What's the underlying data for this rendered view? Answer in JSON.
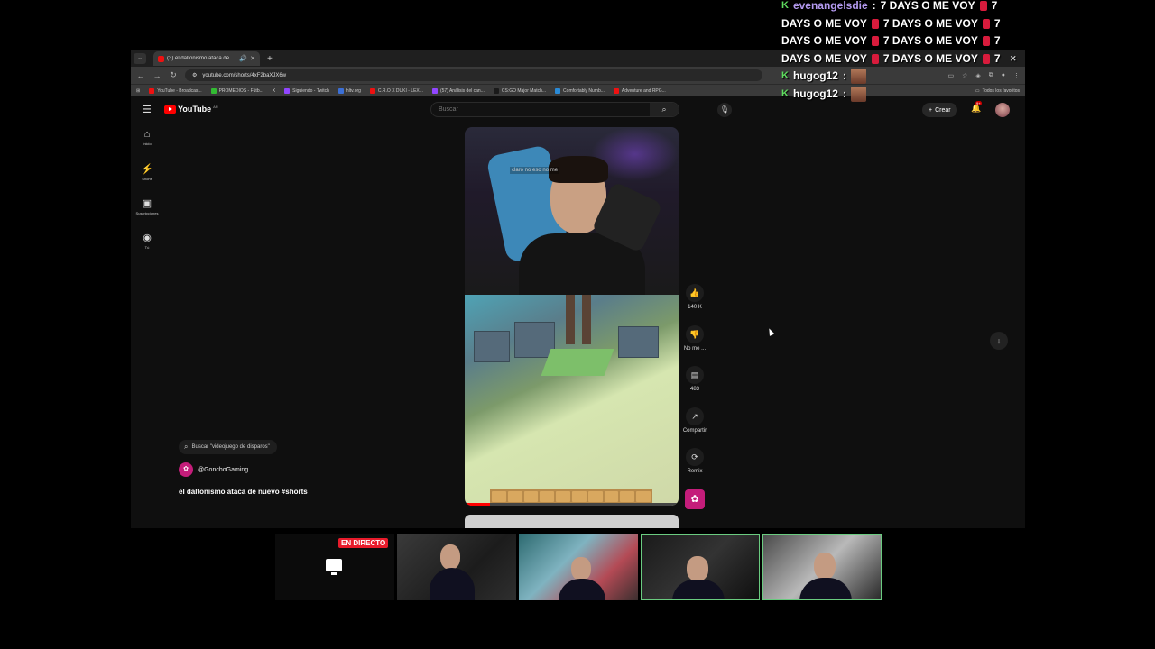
{
  "browser": {
    "tab_title": "(3) el daltonismo ataca de ...",
    "url": "youtube.com/shorts/4xF2baXJX6w",
    "bookmarks": [
      {
        "label": "YouTube - Broadcas...",
        "color": "#e11"
      },
      {
        "label": "PROMEDIOS - Fútb...",
        "color": "#3b3"
      },
      {
        "label": "X",
        "color": "#000"
      },
      {
        "label": "Siguiendo - Twitch",
        "color": "#9146ff"
      },
      {
        "label": "hltv.org",
        "color": "#3b6fd6"
      },
      {
        "label": "C.R.O X DUKI - LEX...",
        "color": "#e11"
      },
      {
        "label": "(57) Análisis del can...",
        "color": "#9146ff"
      },
      {
        "label": "CS:GO Major Match...",
        "color": "#1a1a1a"
      },
      {
        "label": "Comfortably Numb...",
        "color": "#2a8ad6"
      },
      {
        "label": "Adventure and RPG...",
        "color": "#e11"
      }
    ],
    "all_bookmarks": "Todos los favoritos"
  },
  "youtube": {
    "logo": "YouTube",
    "country": "AR",
    "search_placeholder": "Buscar",
    "create_label": "Crear",
    "notification_count": "9+",
    "guide": [
      {
        "icon": "⌂",
        "label": "Inicio"
      },
      {
        "icon": "⚡",
        "label": "Shorts"
      },
      {
        "icon": "▣",
        "label": "Suscripciones"
      },
      {
        "icon": "◉",
        "label": "Tú"
      }
    ],
    "short": {
      "caption": "claro no eso no me",
      "channel": "@GonchoGaming",
      "title": "el daltonismo ataca de nuevo #shorts",
      "search_chip": "Buscar \"videojuego de disparos\"",
      "progress": 0.12
    },
    "actions": [
      {
        "name": "like",
        "icon": "👍",
        "label": "140 K"
      },
      {
        "name": "dislike",
        "icon": "👎",
        "label": "No me ..."
      },
      {
        "name": "comments",
        "icon": "▤",
        "label": "483"
      },
      {
        "name": "share",
        "icon": "↗",
        "label": "Compartir"
      },
      {
        "name": "remix",
        "icon": "⟳",
        "label": "Remix"
      }
    ]
  },
  "chat": [
    {
      "user": "evenangelsdie",
      "message": "7 DAYS O ME VOY",
      "suffix": "7"
    },
    {
      "user": "",
      "message": "DAYS O ME VOY",
      "mid": "7 DAYS O ME VOY",
      "suffix": "7"
    },
    {
      "user": "",
      "message": "DAYS O ME VOY",
      "mid": "7 DAYS O ME VOY",
      "suffix": "7"
    },
    {
      "user": "",
      "message": "DAYS O ME VOY",
      "mid": "7 DAYS O ME VOY",
      "suffix": "7"
    },
    {
      "user": "hugog12",
      "message": ""
    },
    {
      "user": "hugog12",
      "message": ""
    }
  ],
  "stream": {
    "live_label": "EN DIRECTO"
  }
}
